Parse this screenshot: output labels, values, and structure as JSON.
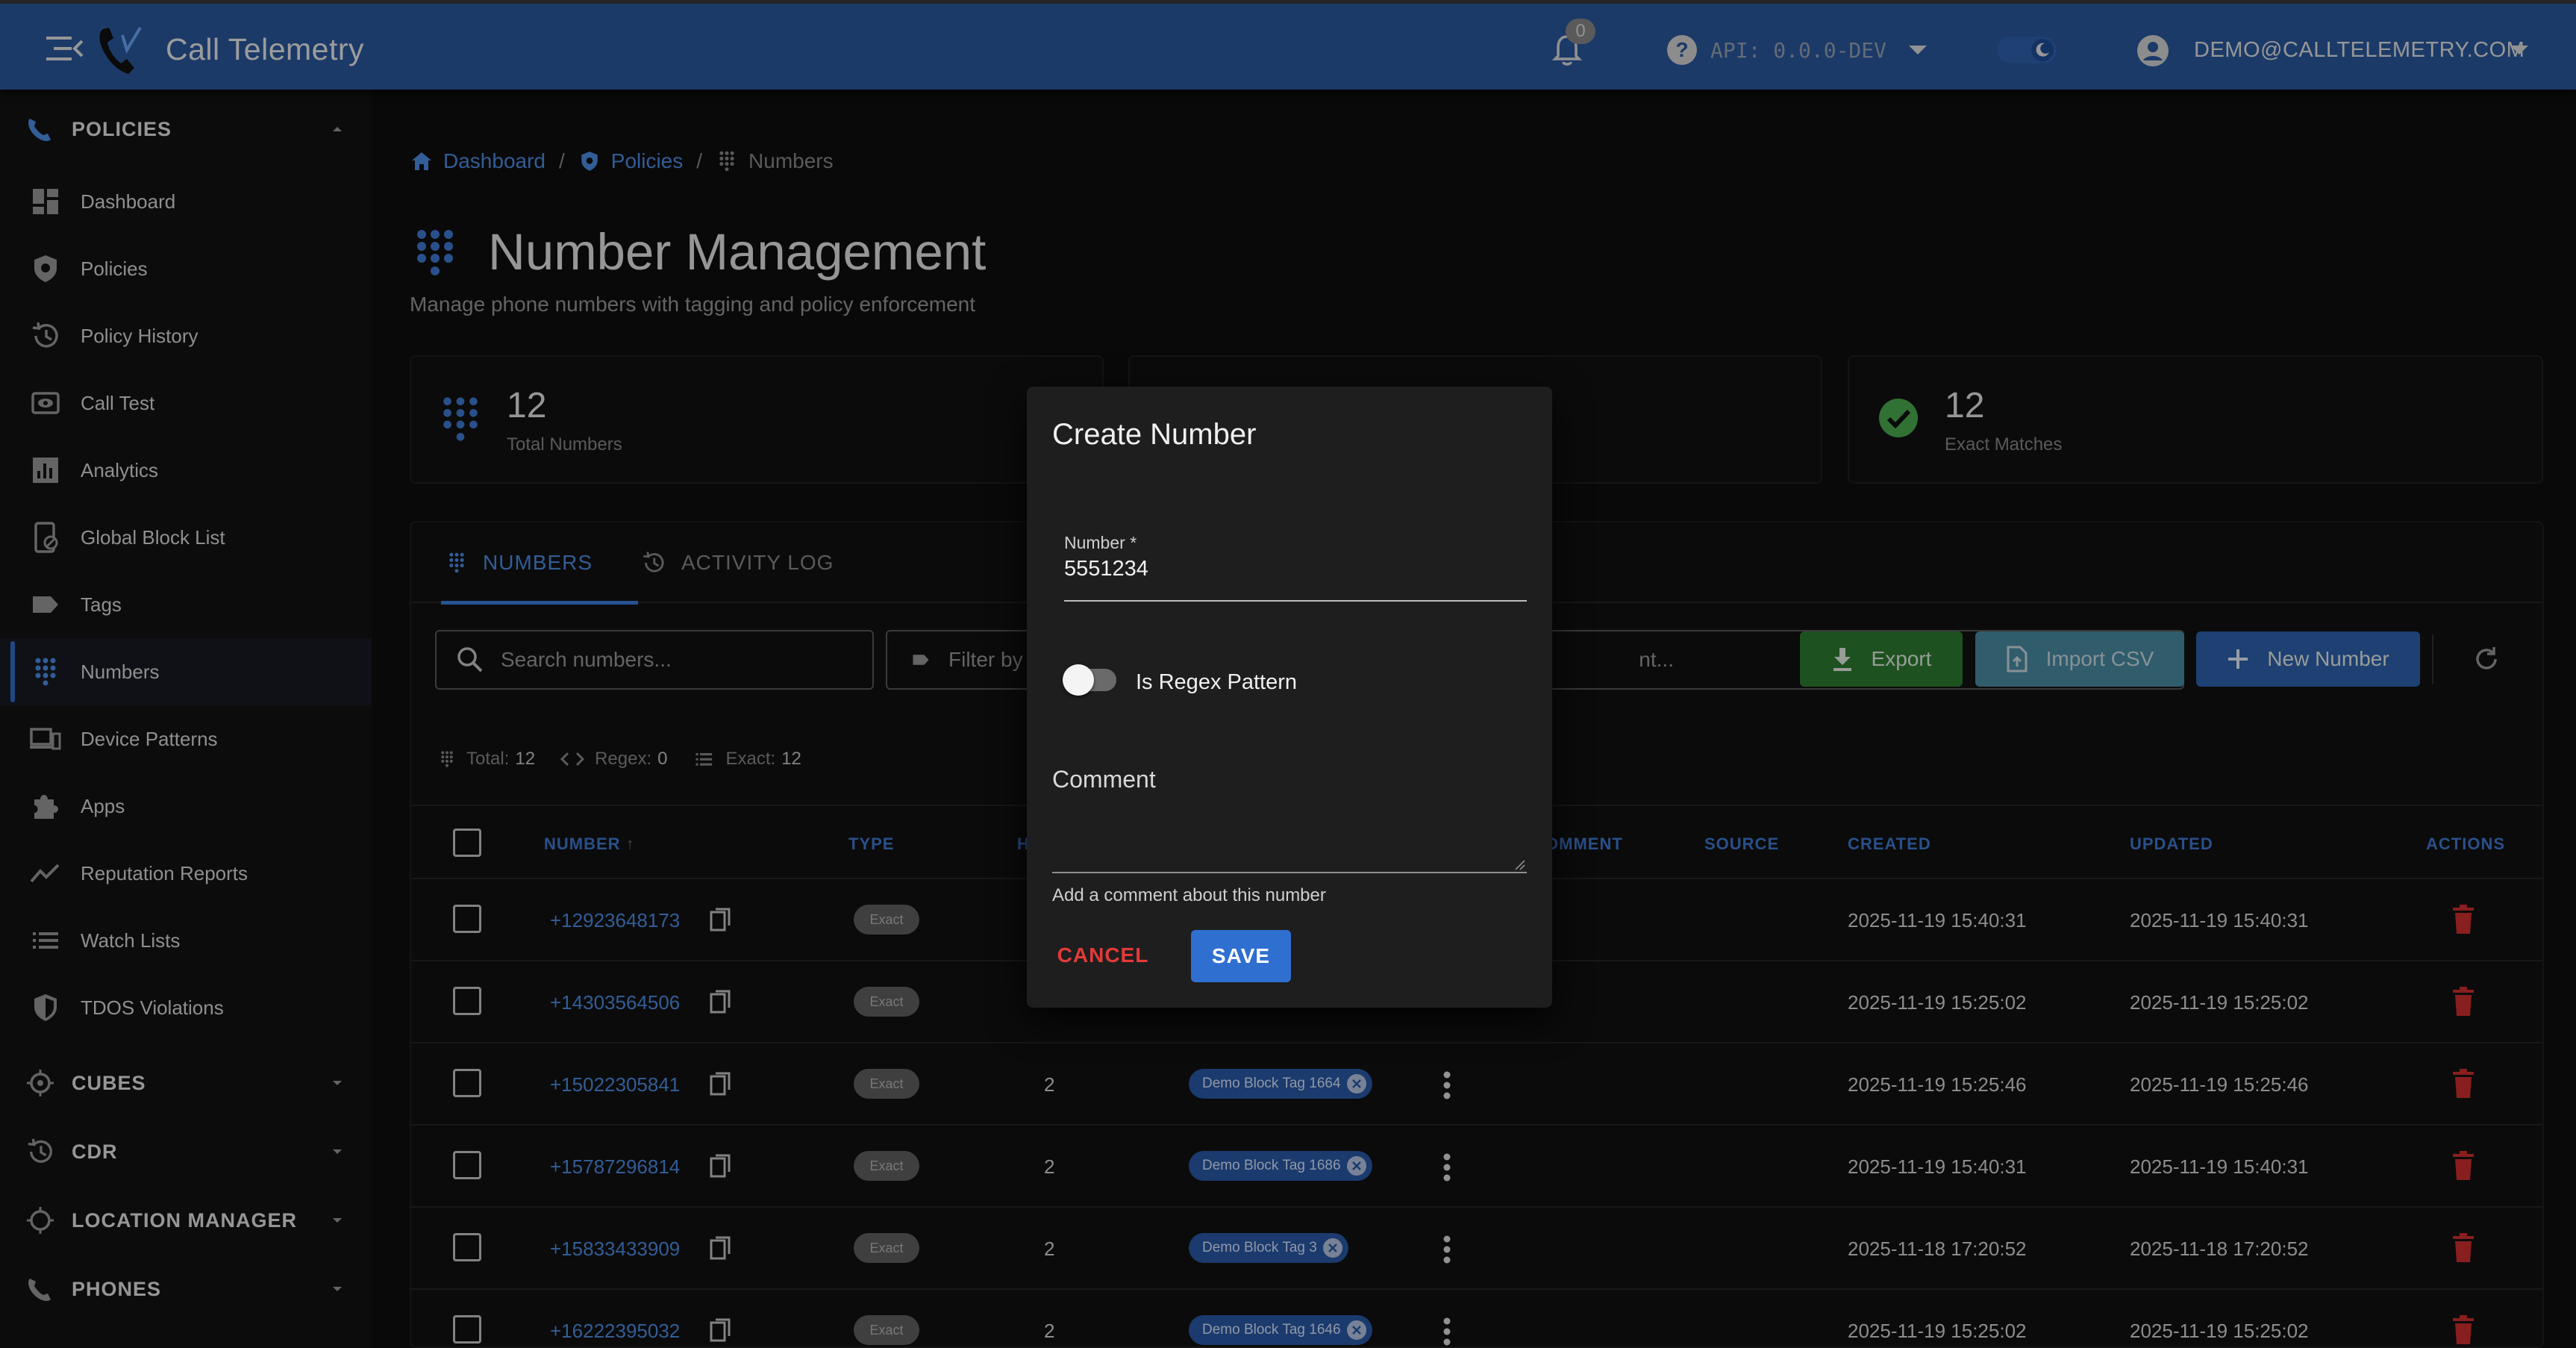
{
  "topbar": {
    "title": "Call Telemetry",
    "notifications_count": "0",
    "api_version": "API: 0.0.0-DEV",
    "user_email": "DEMO@CALLTELEMETRY.COM"
  },
  "sidebar": {
    "sections": [
      {
        "label": "POLICIES",
        "icon": "phone-policy-icon",
        "expanded": true
      },
      {
        "label": "CUBES",
        "icon": "cubes-icon",
        "expanded": false
      },
      {
        "label": "CDR",
        "icon": "history-icon",
        "expanded": false
      },
      {
        "label": "LOCATION MANAGER",
        "icon": "location-icon",
        "expanded": false
      },
      {
        "label": "PHONES",
        "icon": "phone-icon",
        "expanded": false
      }
    ],
    "items": [
      {
        "label": "Dashboard",
        "icon": "dashboard-icon"
      },
      {
        "label": "Policies",
        "icon": "shield-icon"
      },
      {
        "label": "Policy History",
        "icon": "history-icon"
      },
      {
        "label": "Call Test",
        "icon": "eye-icon"
      },
      {
        "label": "Analytics",
        "icon": "analytics-icon"
      },
      {
        "label": "Global Block List",
        "icon": "block-device-icon"
      },
      {
        "label": "Tags",
        "icon": "tag-icon"
      },
      {
        "label": "Numbers",
        "icon": "dialpad-icon",
        "active": true
      },
      {
        "label": "Device Patterns",
        "icon": "devices-icon"
      },
      {
        "label": "Apps",
        "icon": "puzzle-icon"
      },
      {
        "label": "Reputation Reports",
        "icon": "trend-icon"
      },
      {
        "label": "Watch Lists",
        "icon": "list-icon"
      },
      {
        "label": "TDOS Violations",
        "icon": "shield-alert-icon"
      }
    ]
  },
  "breadcrumb": [
    {
      "label": "Dashboard",
      "icon": "home-icon"
    },
    {
      "label": "Policies",
      "icon": "shield-icon"
    },
    {
      "label": "Numbers",
      "icon": "dialpad-icon"
    }
  ],
  "page": {
    "title": "Number Management",
    "subtitle": "Manage phone numbers with tagging and policy enforcement"
  },
  "stats": [
    {
      "value": "12",
      "caption": "Total Numbers",
      "icon": "dialpad-icon"
    },
    {
      "value": "12",
      "caption": "Exact Matches",
      "icon": "check-circle-icon",
      "color": "#4caf50"
    }
  ],
  "tabs": [
    {
      "label": "NUMBERS",
      "active": true
    },
    {
      "label": "ACTIVITY LOG",
      "active": false
    }
  ],
  "toolbar": {
    "search_placeholder": "Search numbers...",
    "filter_placeholder": "Filter by",
    "comment_filter_partial": "nt...",
    "export_label": "Export",
    "import_label": "Import CSV",
    "new_label": "New Number"
  },
  "counts": {
    "total_label": "Total:",
    "total": "12",
    "regex_label": "Regex:",
    "regex": "0",
    "exact_label": "Exact:",
    "exact": "12"
  },
  "table": {
    "headers": [
      "NUMBER",
      "TYPE",
      "H",
      "OMMENT",
      "SOURCE",
      "CREATED",
      "UPDATED",
      "ACTIONS"
    ],
    "rows": [
      {
        "number": "+12923648173",
        "type": "Exact",
        "hits": "",
        "tag": "",
        "created": "2025-11-19 15:40:31",
        "updated": "2025-11-19 15:40:31"
      },
      {
        "number": "+14303564506",
        "type": "Exact",
        "hits": "",
        "tag": "",
        "created": "2025-11-19 15:25:02",
        "updated": "2025-11-19 15:25:02"
      },
      {
        "number": "+15022305841",
        "type": "Exact",
        "hits": "2",
        "tag": "Demo Block Tag 1664",
        "created": "2025-11-19 15:25:46",
        "updated": "2025-11-19 15:25:46"
      },
      {
        "number": "+15787296814",
        "type": "Exact",
        "hits": "2",
        "tag": "Demo Block Tag 1686",
        "created": "2025-11-19 15:40:31",
        "updated": "2025-11-19 15:40:31"
      },
      {
        "number": "+15833433909",
        "type": "Exact",
        "hits": "2",
        "tag": "Demo Block Tag 3",
        "created": "2025-11-18 17:20:52",
        "updated": "2025-11-18 17:20:52"
      },
      {
        "number": "+16222395032",
        "type": "Exact",
        "hits": "2",
        "tag": "Demo Block Tag 1646",
        "created": "2025-11-19 15:25:02",
        "updated": "2025-11-19 15:25:02"
      }
    ]
  },
  "modal": {
    "title": "Create Number",
    "number_label": "Number *",
    "number_value": "5551234",
    "regex_label": "Is Regex Pattern",
    "regex_enabled": false,
    "comment_label": "Comment",
    "comment_helper": "Add a comment about this number",
    "cancel_label": "CANCEL",
    "save_label": "SAVE"
  },
  "colors": {
    "topbar": "#2a5aa0",
    "accent": "#3a7fe0",
    "export": "#2e7d32",
    "import": "#4a8ea6",
    "new": "#2f63b0",
    "danger": "#d32f2f"
  }
}
